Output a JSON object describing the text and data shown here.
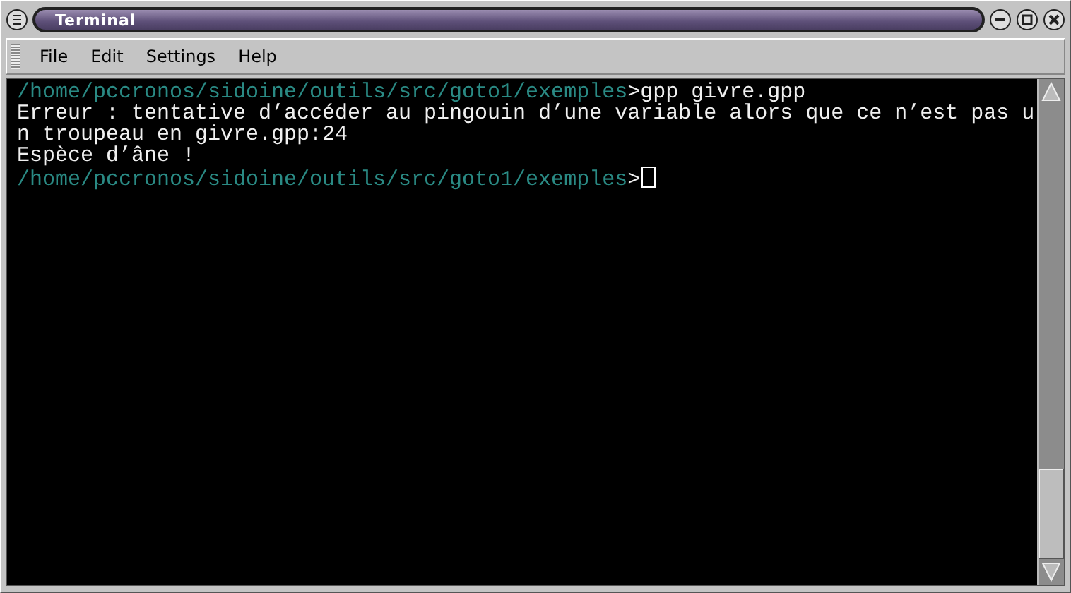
{
  "window": {
    "title": "Terminal"
  },
  "menu": [
    "File",
    "Edit",
    "Settings",
    "Help"
  ],
  "terminal": {
    "lines": [
      {
        "path": "/home/pccronos/sidoine/outils/src/goto1/exemples",
        "text": ">gpp givre.gpp",
        "cursor": false
      },
      {
        "text": "Erreur : tentative d’accéder au pingouin d’une variable alors que ce n’est pas u",
        "cursor": false
      },
      {
        "text": "n troupeau en givre.gpp:24",
        "cursor": false
      },
      {
        "text": "Espèce d’âne !",
        "cursor": false
      },
      {
        "path": "/home/pccronos/sidoine/outils/src/goto1/exemples",
        "text": ">",
        "cursor": true
      }
    ]
  }
}
